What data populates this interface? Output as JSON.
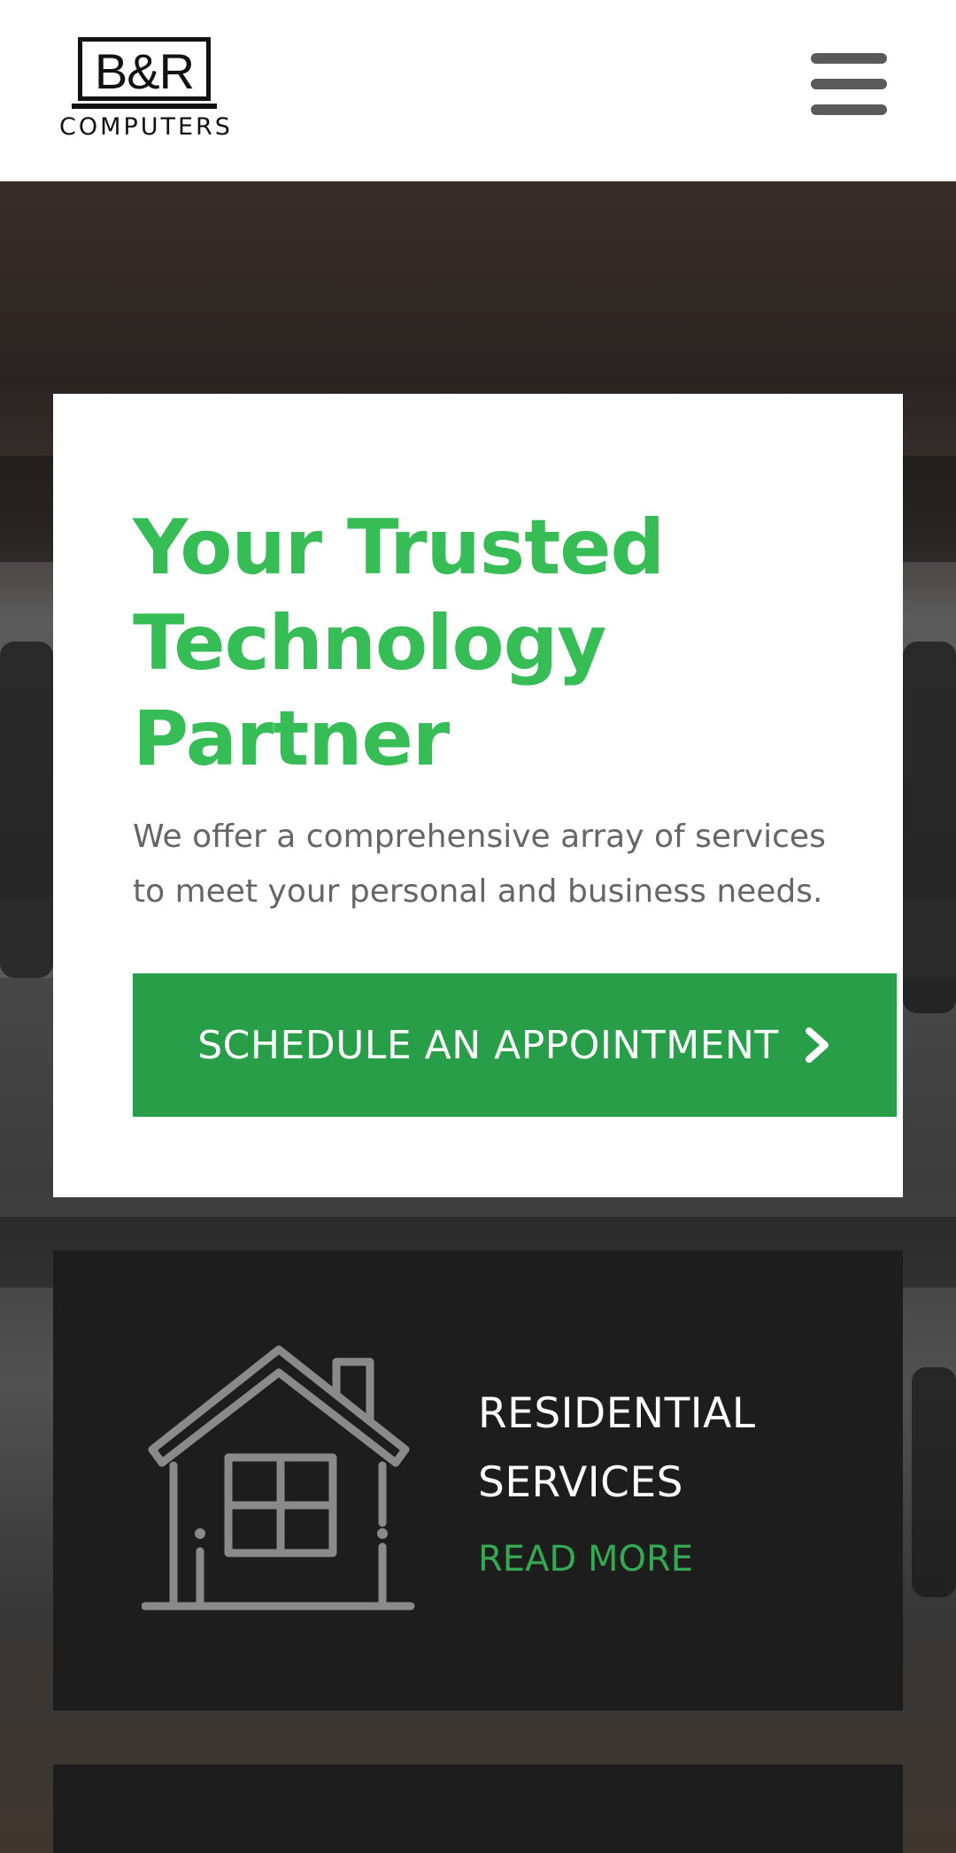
{
  "header": {
    "logo_mark": "B&R",
    "logo_subtitle": "COMPUTERS",
    "menu_icon": "hamburger-menu-icon"
  },
  "hero": {
    "title": "Your Trusted Technology Partner",
    "description": "We offer a comprehensive array of services to meet your personal and business needs.",
    "cta_label": "SCHEDULE AN APPOINTMENT",
    "cta_icon": "chevron-right-icon"
  },
  "services": [
    {
      "icon": "house-icon",
      "title": "RESIDENTIAL SERVICES",
      "link_label": "READ MORE"
    }
  ],
  "colors": {
    "accent_green": "#36bd55",
    "button_green": "#289e48",
    "link_green": "#35a853",
    "card_dark": "#1d1d1d",
    "menu_gray": "#5a5a5a"
  }
}
